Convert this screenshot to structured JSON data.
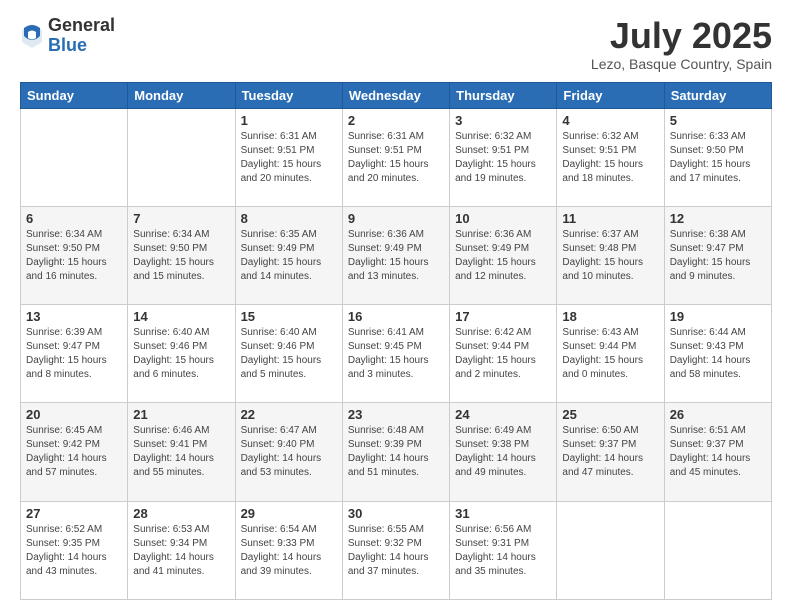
{
  "logo": {
    "general": "General",
    "blue": "Blue"
  },
  "title": "July 2025",
  "location": "Lezo, Basque Country, Spain",
  "days_of_week": [
    "Sunday",
    "Monday",
    "Tuesday",
    "Wednesday",
    "Thursday",
    "Friday",
    "Saturday"
  ],
  "weeks": [
    [
      {
        "day": null,
        "sunrise": null,
        "sunset": null,
        "daylight": null
      },
      {
        "day": null,
        "sunrise": null,
        "sunset": null,
        "daylight": null
      },
      {
        "day": "1",
        "sunrise": "6:31 AM",
        "sunset": "9:51 PM",
        "daylight": "15 hours and 20 minutes."
      },
      {
        "day": "2",
        "sunrise": "6:31 AM",
        "sunset": "9:51 PM",
        "daylight": "15 hours and 20 minutes."
      },
      {
        "day": "3",
        "sunrise": "6:32 AM",
        "sunset": "9:51 PM",
        "daylight": "15 hours and 19 minutes."
      },
      {
        "day": "4",
        "sunrise": "6:32 AM",
        "sunset": "9:51 PM",
        "daylight": "15 hours and 18 minutes."
      },
      {
        "day": "5",
        "sunrise": "6:33 AM",
        "sunset": "9:50 PM",
        "daylight": "15 hours and 17 minutes."
      }
    ],
    [
      {
        "day": "6",
        "sunrise": "6:34 AM",
        "sunset": "9:50 PM",
        "daylight": "15 hours and 16 minutes."
      },
      {
        "day": "7",
        "sunrise": "6:34 AM",
        "sunset": "9:50 PM",
        "daylight": "15 hours and 15 minutes."
      },
      {
        "day": "8",
        "sunrise": "6:35 AM",
        "sunset": "9:49 PM",
        "daylight": "15 hours and 14 minutes."
      },
      {
        "day": "9",
        "sunrise": "6:36 AM",
        "sunset": "9:49 PM",
        "daylight": "15 hours and 13 minutes."
      },
      {
        "day": "10",
        "sunrise": "6:36 AM",
        "sunset": "9:49 PM",
        "daylight": "15 hours and 12 minutes."
      },
      {
        "day": "11",
        "sunrise": "6:37 AM",
        "sunset": "9:48 PM",
        "daylight": "15 hours and 10 minutes."
      },
      {
        "day": "12",
        "sunrise": "6:38 AM",
        "sunset": "9:47 PM",
        "daylight": "15 hours and 9 minutes."
      }
    ],
    [
      {
        "day": "13",
        "sunrise": "6:39 AM",
        "sunset": "9:47 PM",
        "daylight": "15 hours and 8 minutes."
      },
      {
        "day": "14",
        "sunrise": "6:40 AM",
        "sunset": "9:46 PM",
        "daylight": "15 hours and 6 minutes."
      },
      {
        "day": "15",
        "sunrise": "6:40 AM",
        "sunset": "9:46 PM",
        "daylight": "15 hours and 5 minutes."
      },
      {
        "day": "16",
        "sunrise": "6:41 AM",
        "sunset": "9:45 PM",
        "daylight": "15 hours and 3 minutes."
      },
      {
        "day": "17",
        "sunrise": "6:42 AM",
        "sunset": "9:44 PM",
        "daylight": "15 hours and 2 minutes."
      },
      {
        "day": "18",
        "sunrise": "6:43 AM",
        "sunset": "9:44 PM",
        "daylight": "15 hours and 0 minutes."
      },
      {
        "day": "19",
        "sunrise": "6:44 AM",
        "sunset": "9:43 PM",
        "daylight": "14 hours and 58 minutes."
      }
    ],
    [
      {
        "day": "20",
        "sunrise": "6:45 AM",
        "sunset": "9:42 PM",
        "daylight": "14 hours and 57 minutes."
      },
      {
        "day": "21",
        "sunrise": "6:46 AM",
        "sunset": "9:41 PM",
        "daylight": "14 hours and 55 minutes."
      },
      {
        "day": "22",
        "sunrise": "6:47 AM",
        "sunset": "9:40 PM",
        "daylight": "14 hours and 53 minutes."
      },
      {
        "day": "23",
        "sunrise": "6:48 AM",
        "sunset": "9:39 PM",
        "daylight": "14 hours and 51 minutes."
      },
      {
        "day": "24",
        "sunrise": "6:49 AM",
        "sunset": "9:38 PM",
        "daylight": "14 hours and 49 minutes."
      },
      {
        "day": "25",
        "sunrise": "6:50 AM",
        "sunset": "9:37 PM",
        "daylight": "14 hours and 47 minutes."
      },
      {
        "day": "26",
        "sunrise": "6:51 AM",
        "sunset": "9:37 PM",
        "daylight": "14 hours and 45 minutes."
      }
    ],
    [
      {
        "day": "27",
        "sunrise": "6:52 AM",
        "sunset": "9:35 PM",
        "daylight": "14 hours and 43 minutes."
      },
      {
        "day": "28",
        "sunrise": "6:53 AM",
        "sunset": "9:34 PM",
        "daylight": "14 hours and 41 minutes."
      },
      {
        "day": "29",
        "sunrise": "6:54 AM",
        "sunset": "9:33 PM",
        "daylight": "14 hours and 39 minutes."
      },
      {
        "day": "30",
        "sunrise": "6:55 AM",
        "sunset": "9:32 PM",
        "daylight": "14 hours and 37 minutes."
      },
      {
        "day": "31",
        "sunrise": "6:56 AM",
        "sunset": "9:31 PM",
        "daylight": "14 hours and 35 minutes."
      },
      {
        "day": null,
        "sunrise": null,
        "sunset": null,
        "daylight": null
      },
      {
        "day": null,
        "sunrise": null,
        "sunset": null,
        "daylight": null
      }
    ]
  ],
  "labels": {
    "sunrise": "Sunrise:",
    "sunset": "Sunset:",
    "daylight": "Daylight:"
  }
}
